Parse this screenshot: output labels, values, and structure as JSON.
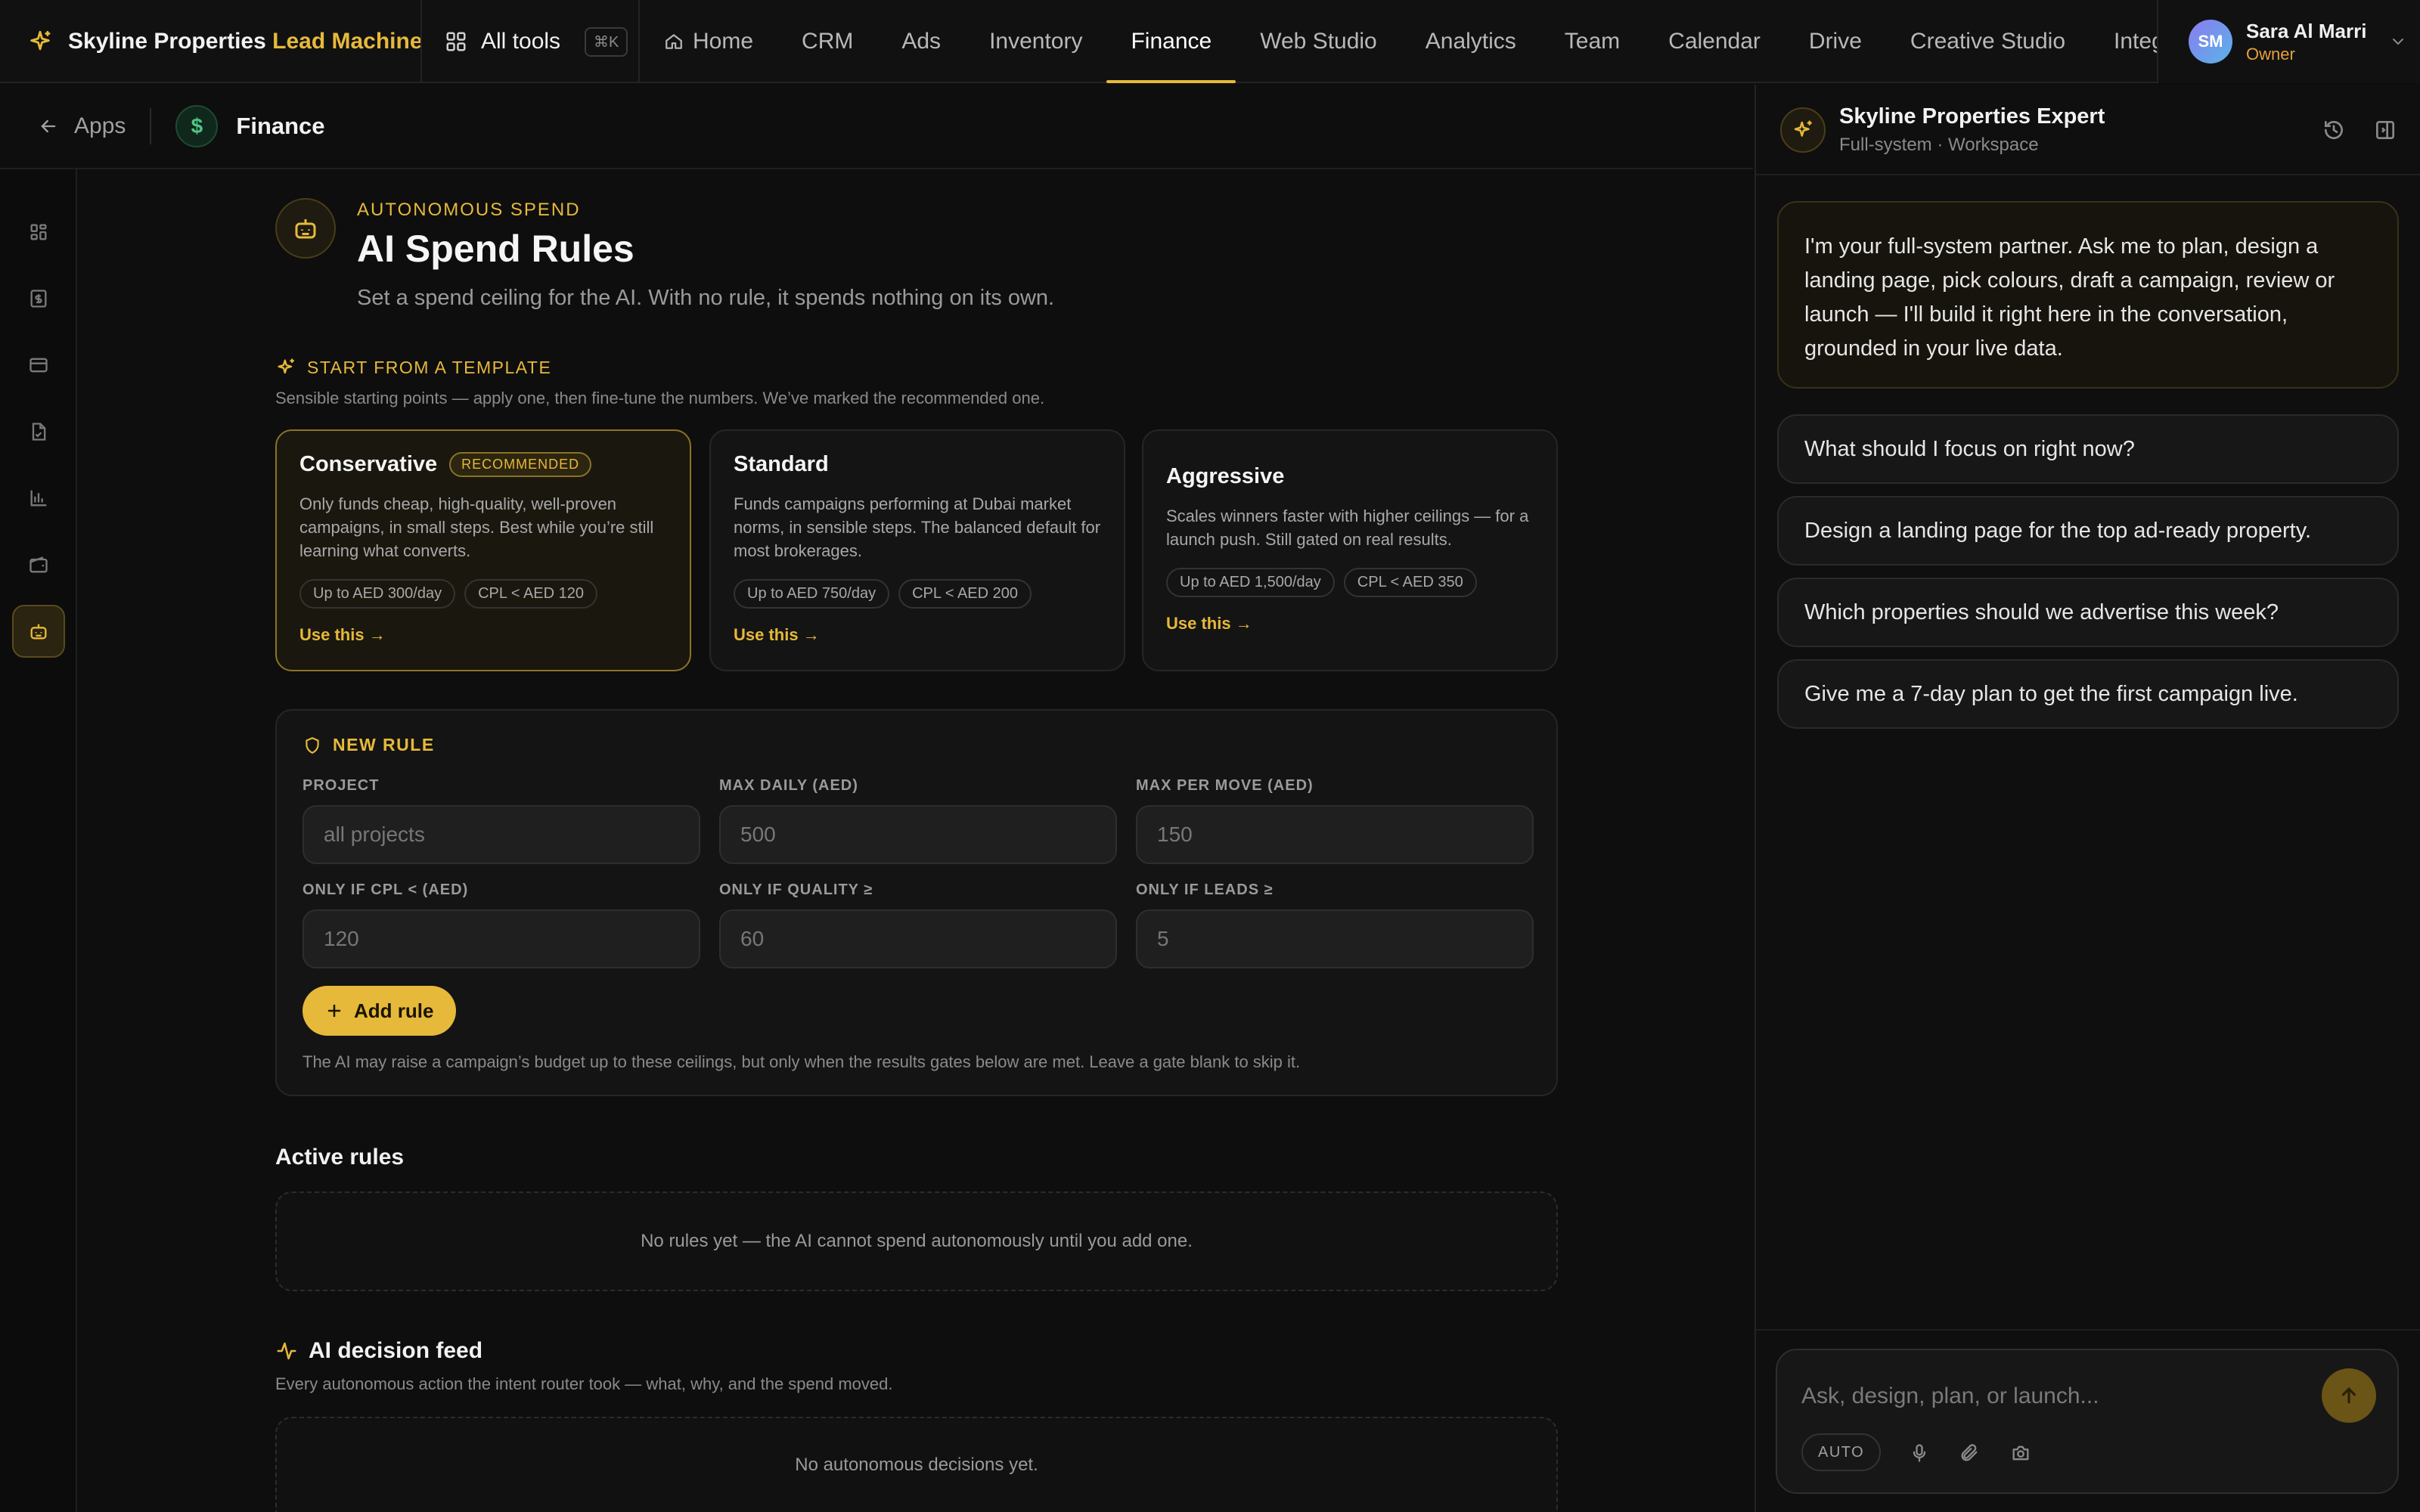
{
  "brand": {
    "name": "Skyline Properties",
    "accent": "Lead Machine"
  },
  "all_tools": {
    "label": "All tools",
    "shortcut": "⌘K"
  },
  "nav": [
    {
      "label": "Home",
      "icon": "home-icon"
    },
    {
      "label": "CRM"
    },
    {
      "label": "Ads"
    },
    {
      "label": "Inventory"
    },
    {
      "label": "Finance",
      "active": true
    },
    {
      "label": "Web Studio"
    },
    {
      "label": "Analytics"
    },
    {
      "label": "Team"
    },
    {
      "label": "Calendar"
    },
    {
      "label": "Drive"
    },
    {
      "label": "Creative Studio"
    },
    {
      "label": "Integ"
    }
  ],
  "user": {
    "initials": "SM",
    "name": "Sara Al Marri",
    "role": "Owner"
  },
  "subheader": {
    "back_label": "Apps",
    "app_symbol": "$",
    "app_name": "Finance"
  },
  "rail": [
    "grid-icon",
    "dollar-doc-icon",
    "card-icon",
    "invoice-icon",
    "bar-chart-icon",
    "wallet-icon",
    "robot-icon"
  ],
  "hero": {
    "eyebrow": "AUTONOMOUS SPEND",
    "title": "AI Spend Rules",
    "subtitle": "Set a spend ceiling for the AI. With no rule, it spends nothing on its own."
  },
  "templates": {
    "heading": "START FROM A TEMPLATE",
    "subheading": "Sensible starting points — apply one, then fine-tune the numbers. We’ve marked the recommended one.",
    "items": [
      {
        "title": "Conservative",
        "badge": "RECOMMENDED",
        "description": "Only funds cheap, high-quality, well-proven campaigns, in small steps. Best while you’re still learning what converts.",
        "chips": [
          "Up to AED 300/day",
          "CPL < AED 120"
        ],
        "cta": "Use this →"
      },
      {
        "title": "Standard",
        "description": "Funds campaigns performing at Dubai market norms, in sensible steps. The balanced default for most brokerages.",
        "chips": [
          "Up to AED 750/day",
          "CPL < AED 200"
        ],
        "cta": "Use this →"
      },
      {
        "title": "Aggressive",
        "description": "Scales winners faster with higher ceilings — for a launch push. Still gated on real results.",
        "chips": [
          "Up to AED 1,500/day",
          "CPL < AED 350"
        ],
        "cta": "Use this →"
      }
    ]
  },
  "new_rule": {
    "heading": "NEW RULE",
    "fields": [
      {
        "label": "PROJECT",
        "placeholder": "all projects"
      },
      {
        "label": "MAX DAILY (AED)",
        "placeholder": "500"
      },
      {
        "label": "MAX PER MOVE (AED)",
        "placeholder": "150"
      },
      {
        "label": "ONLY IF CPL < (AED)",
        "placeholder": "120"
      },
      {
        "label": "ONLY IF QUALITY ≥",
        "placeholder": "60"
      },
      {
        "label": "ONLY IF LEADS ≥",
        "placeholder": "5"
      }
    ],
    "add_button": "Add rule",
    "note": "The AI may raise a campaign’s budget up to these ceilings, but only when the results gates below are met. Leave a gate blank to skip it."
  },
  "active_rules": {
    "title": "Active rules",
    "empty": "No rules yet — the AI cannot spend autonomously until you add one."
  },
  "decision_feed": {
    "title": "AI decision feed",
    "subtitle": "Every autonomous action the intent router took — what, why, and the spend moved.",
    "empty": "No autonomous decisions yet."
  },
  "assistant": {
    "title": "Skyline Properties Expert",
    "subtitle": "Full-system · Workspace",
    "intro": "I'm your full-system partner. Ask me to plan, design a landing page, pick colours, draft a campaign, review or launch — I'll build it right here in the conversation, grounded in your live data.",
    "suggestions": [
      "What should I focus on right now?",
      "Design a landing page for the top ad-ready property.",
      "Which properties should we advertise this week?",
      "Give me a 7-day plan to get the first campaign live."
    ],
    "composer_placeholder": "Ask, design, plan, or launch...",
    "mode_chip": "AUTO"
  },
  "colors": {
    "accent": "#e6b93a",
    "background": "#0e0e0e",
    "finance_green": "#4fc486",
    "owner_orange": "#e6a03a"
  }
}
